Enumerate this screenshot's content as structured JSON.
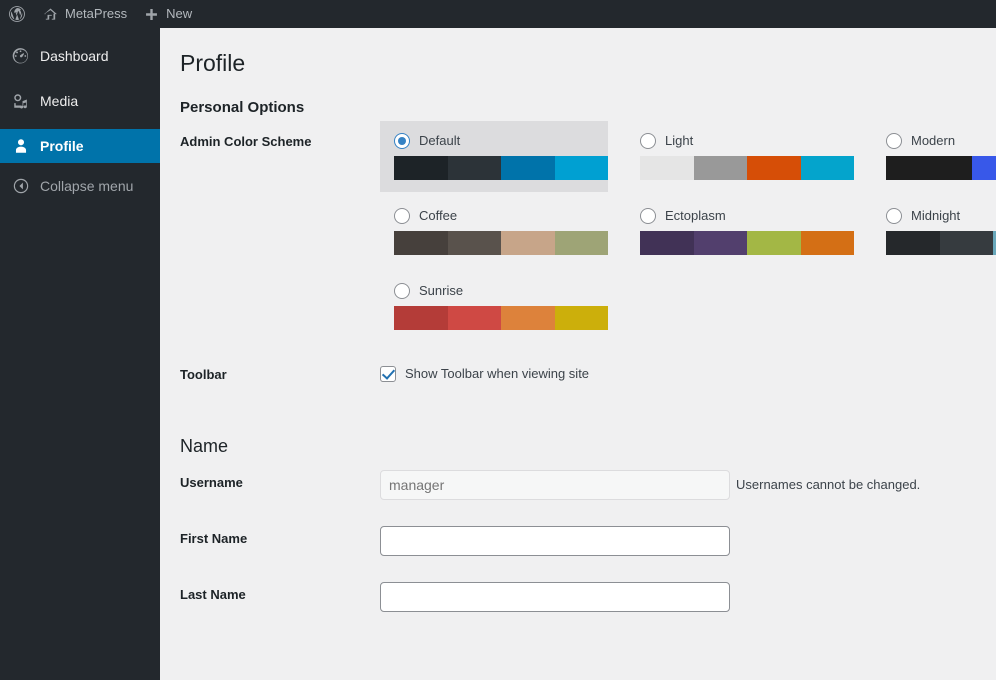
{
  "adminbar": {
    "items": [
      {
        "id": "wp-logo",
        "icon": "wordpress-icon",
        "label": ""
      },
      {
        "id": "site-name",
        "icon": "home-icon",
        "label": "MetaPress"
      },
      {
        "id": "new-content",
        "icon": "plus-icon",
        "label": "New"
      }
    ]
  },
  "sidebar": {
    "items": [
      {
        "icon": "dashboard-icon",
        "label": "Dashboard",
        "current": false
      },
      {
        "icon": "media-icon",
        "label": "Media",
        "current": false
      },
      {
        "icon": "user-icon",
        "label": "Profile",
        "current": true
      }
    ],
    "collapse": {
      "icon": "collapse-arrow-icon",
      "label": "Collapse menu"
    }
  },
  "page": {
    "title": "Profile",
    "personal_options_heading": "Personal Options",
    "name_heading": "Name"
  },
  "color_scheme": {
    "label": "Admin Color Scheme",
    "selected": "Default",
    "options": [
      {
        "name": "Default",
        "selected": true,
        "colors": [
          "#1d2327",
          "#2c3338",
          "#0073aa",
          "#00a0d2"
        ]
      },
      {
        "name": "Light",
        "selected": false,
        "colors": [
          "#e5e5e5",
          "#999999",
          "#d64e07",
          "#04a4cc"
        ]
      },
      {
        "name": "Modern",
        "selected": false,
        "colors": [
          "#1e1e1e",
          "#3858e9",
          "#33f078",
          "#e26f56"
        ]
      },
      {
        "name": "Coffee",
        "selected": false,
        "colors": [
          "#46403c",
          "#59524c",
          "#c7a589",
          "#9ea476"
        ]
      },
      {
        "name": "Ectoplasm",
        "selected": false,
        "colors": [
          "#413256",
          "#523f6d",
          "#a3b745",
          "#d46f15"
        ]
      },
      {
        "name": "Midnight",
        "selected": false,
        "colors": [
          "#25282b",
          "#363b3f",
          "#69a8bb",
          "#e14d43"
        ]
      },
      {
        "name": "Sunrise",
        "selected": false,
        "colors": [
          "#b43c38",
          "#cf4944",
          "#dd823b",
          "#ccaf0b"
        ]
      }
    ]
  },
  "toolbar": {
    "label": "Toolbar",
    "checkbox_label": "Show Toolbar when viewing site",
    "checked": true
  },
  "fields": {
    "username": {
      "label": "Username",
      "value": "",
      "placeholder": "manager",
      "note": "Usernames cannot be changed.",
      "disabled": true
    },
    "first_name": {
      "label": "First Name",
      "value": "",
      "placeholder": ""
    },
    "last_name": {
      "label": "Last Name",
      "value": "",
      "placeholder": ""
    }
  }
}
